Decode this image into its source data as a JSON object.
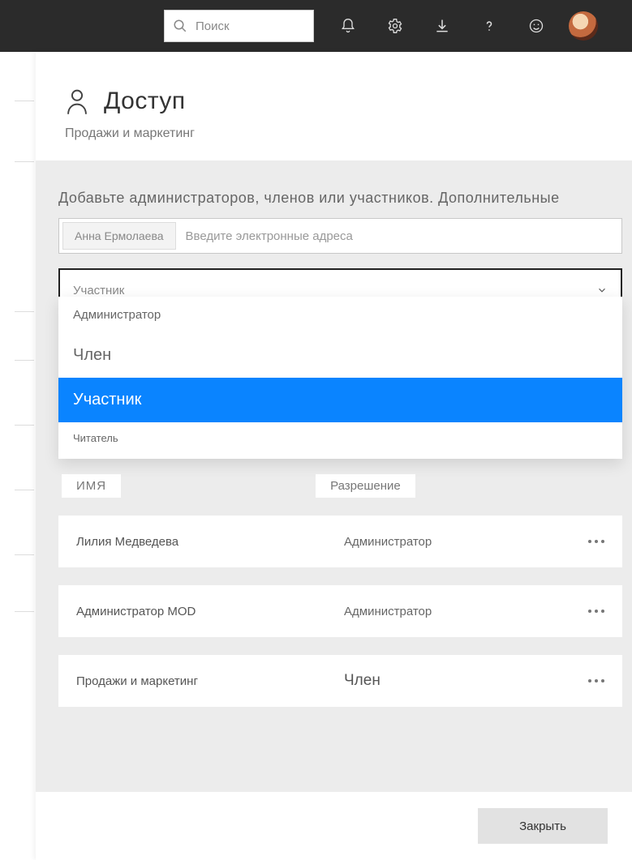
{
  "topbar": {
    "search_placeholder": "Поиск"
  },
  "header": {
    "title": "Доступ",
    "subtitle": "Продажи и маркетинг"
  },
  "body": {
    "instruction": "Добавьте администраторов, членов или участников. Дополнительные",
    "chip_name": "Анна Ермолаева",
    "email_placeholder": "Введите электронные адреса",
    "selected_role": "Участник"
  },
  "dropdown": {
    "opt_admin": "Администратор",
    "opt_member": "Член",
    "opt_participant": "Участник",
    "opt_reader": "Читатель"
  },
  "table": {
    "header_name": "ИМЯ",
    "header_perm": "Разрешение",
    "rows": [
      {
        "name": "Лилия Медведева",
        "perm": "Администратор"
      },
      {
        "name": "Администратор MOD",
        "perm": "Администратор"
      },
      {
        "name": "Продажи и маркетинг",
        "perm": "Член"
      }
    ]
  },
  "footer": {
    "close_label": "Закрыть"
  }
}
